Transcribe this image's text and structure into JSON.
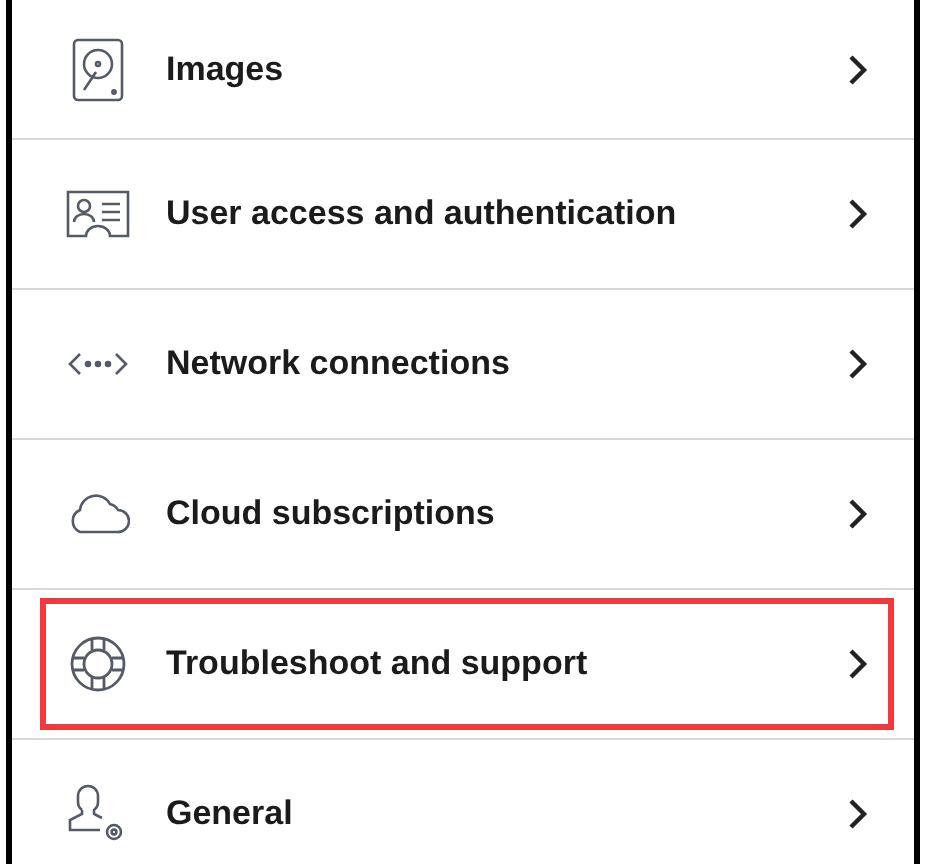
{
  "items": [
    {
      "label": "Images",
      "highlighted": false
    },
    {
      "label": "User access and authentication",
      "highlighted": false
    },
    {
      "label": "Network connections",
      "highlighted": false
    },
    {
      "label": "Cloud subscriptions",
      "highlighted": false
    },
    {
      "label": "Troubleshoot and support",
      "highlighted": true
    },
    {
      "label": "General",
      "highlighted": false
    }
  ]
}
